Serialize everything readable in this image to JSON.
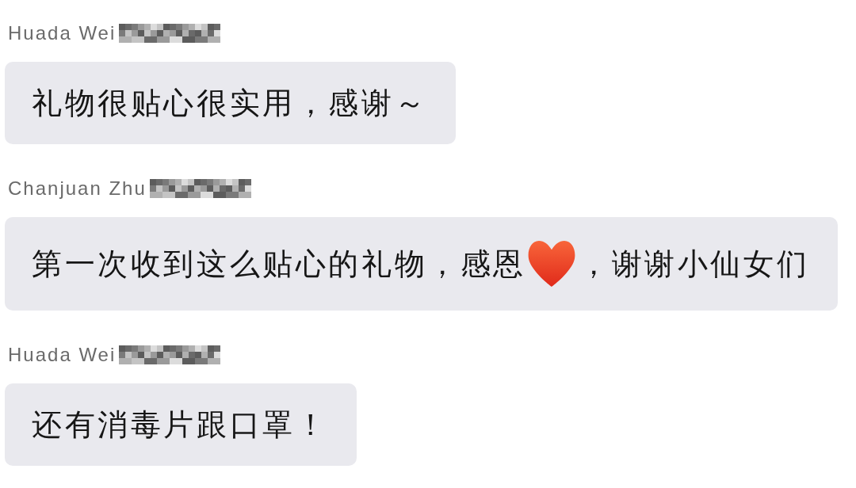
{
  "messages": [
    {
      "sender": "Huada Wei",
      "sender_redacted": true,
      "parts": [
        {
          "kind": "text",
          "text": "礼物很贴心很实用，感谢～"
        }
      ]
    },
    {
      "sender": "Chanjuan Zhu",
      "sender_redacted": true,
      "parts": [
        {
          "kind": "text",
          "text": "第一次收到这么贴心的礼物，感恩"
        },
        {
          "kind": "heart"
        },
        {
          "kind": "text",
          "text": "，谢谢小仙女们"
        }
      ]
    },
    {
      "sender": "Huada Wei",
      "sender_redacted": true,
      "parts": [
        {
          "kind": "text",
          "text": "还有消毒片跟口罩！"
        }
      ]
    }
  ]
}
